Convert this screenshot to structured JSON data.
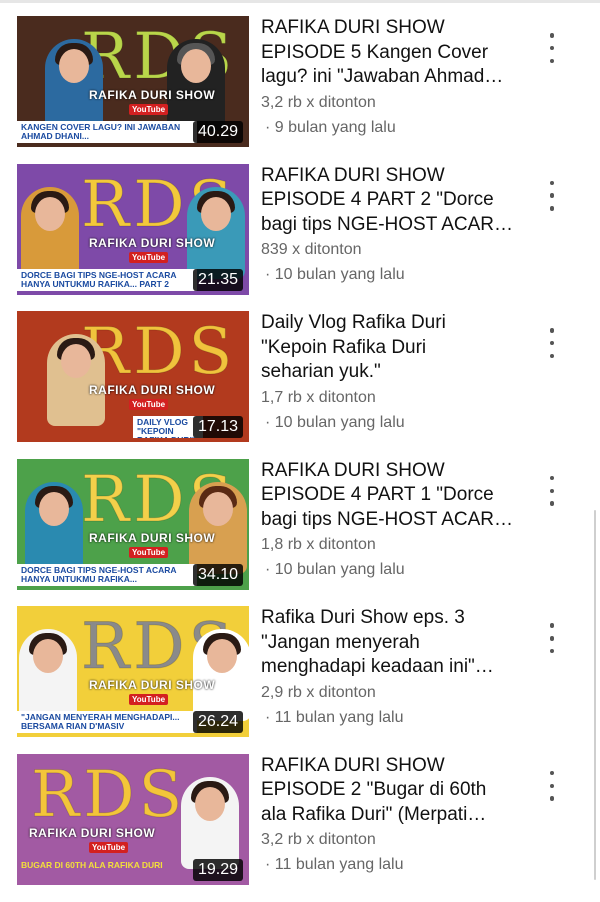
{
  "videos": [
    {
      "title": "RAFIKA DURI SHOW\nEPISODE 5 Kangen Cover\nlagu? ini \"Jawaban Ahmad…",
      "views": "3,2 rb x ditonton",
      "age": "· 9 bulan yang lalu",
      "duration": "40.29",
      "thumb_logo": "RDS",
      "thumb_show": "RAFIKA DURI SHOW",
      "thumb_yt": "YouTube",
      "thumb_caption": "KANGEN COVER LAGU? INI JAWABAN AHMAD DHANI...",
      "bg": "#4a2b1e",
      "logo_color": "#b9d64a"
    },
    {
      "title": "RAFIKA DURI SHOW\nEPISODE 4 PART 2 \"Dorce\nbagi tips NGE-HOST ACAR…",
      "views": "839 x ditonton",
      "age": "· 10 bulan yang lalu",
      "duration": "21.35",
      "thumb_logo": "RDS",
      "thumb_show": "RAFIKA DURI SHOW",
      "thumb_yt": "YouTube",
      "thumb_caption": "DORCE BAGI TIPS NGE-HOST ACARA HANYA UNTUKMU RAFIKA... PART 2",
      "bg": "#7e4aa8",
      "logo_color": "#f3c93b"
    },
    {
      "title": "Daily Vlog Rafika Duri\n\"Kepoin Rafika Duri\nseharian yuk.\"",
      "views": "1,7 rb x ditonton",
      "age": "· 10 bulan yang lalu",
      "duration": "17.13",
      "thumb_logo": "RDS",
      "thumb_show": "RAFIKA DURI SHOW",
      "thumb_yt": "YouTube",
      "thumb_caption": "DAILY VLOG \"KEPOIN RAFIKA DURI\"",
      "bg": "#b23a1e",
      "logo_color": "#f0c33c"
    },
    {
      "title": "RAFIKA DURI SHOW\nEPISODE 4 PART 1 \"Dorce\nbagi tips NGE-HOST ACAR…",
      "views": "1,8 rb x ditonton",
      "age": "· 10 bulan yang lalu",
      "duration": "34.10",
      "thumb_logo": "RDS",
      "thumb_show": "RAFIKA DURI SHOW",
      "thumb_yt": "YouTube",
      "thumb_caption": "DORCE BAGI TIPS NGE-HOST ACARA HANYA UNTUKMU RAFIKA...",
      "bg": "#4da14a",
      "logo_color": "#f3d04a"
    },
    {
      "title": "Rafika Duri Show eps. 3\n\"Jangan menyerah\nmenghadapi keadaan ini\"…",
      "views": "2,9 rb x ditonton",
      "age": "· 11 bulan yang lalu",
      "duration": "26.24",
      "thumb_logo": "RDS",
      "thumb_show": "RAFIKA DURI SHOW",
      "thumb_yt": "YouTube",
      "thumb_caption": "\"JANGAN MENYERAH MENGHADAPI... BERSAMA RIAN D'MASIV",
      "bg": "#f2cf3a",
      "logo_color": "#8a8a8a"
    },
    {
      "title": "RAFIKA DURI SHOW\nEPISODE 2 \"Bugar di 60th\nala Rafika Duri\" (Merpati…",
      "views": "3,2 rb x ditonton",
      "age": "· 11 bulan yang lalu",
      "duration": "19.29",
      "thumb_logo": "RDS",
      "thumb_show": "RAFIKA DURI SHOW",
      "thumb_yt": "YouTube",
      "thumb_caption": "BUGAR DI 60TH ALA RAFIKA DURI",
      "bg": "#a25aa3",
      "logo_color": "#f3c53a"
    }
  ]
}
